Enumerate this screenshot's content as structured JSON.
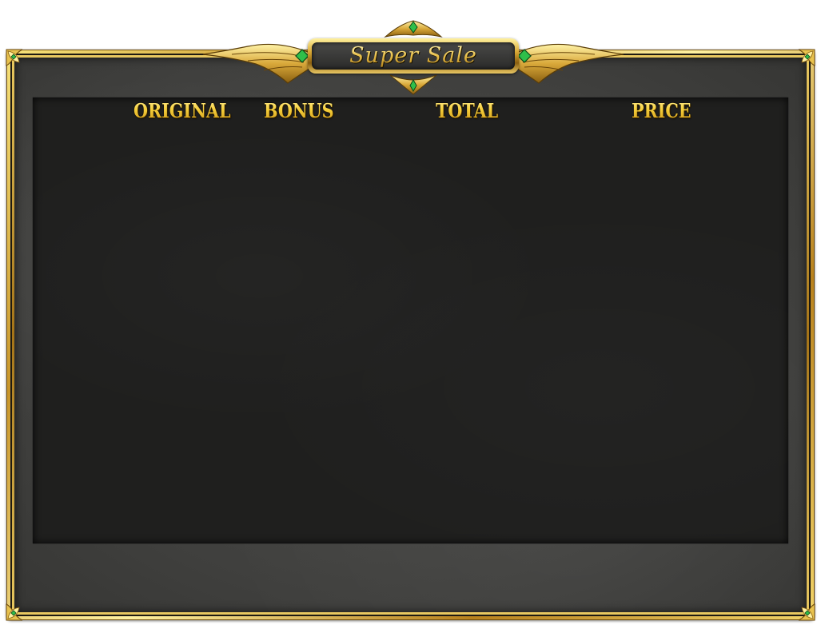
{
  "title": "Super Sale",
  "columns": {
    "original": "ORIGINAL",
    "bonus": "BONUS",
    "total": "TOTAL",
    "price": "PRICE"
  },
  "colors": {
    "gold": "#f4c93a",
    "frame_gold": "#c9962a",
    "stone": "#484846",
    "content_bg": "#1f1f1e",
    "gem": "#2fbf4a"
  },
  "icons": [
    "wing-icon",
    "gem-icon",
    "corner-ornament-icon",
    "crest-icon"
  ]
}
